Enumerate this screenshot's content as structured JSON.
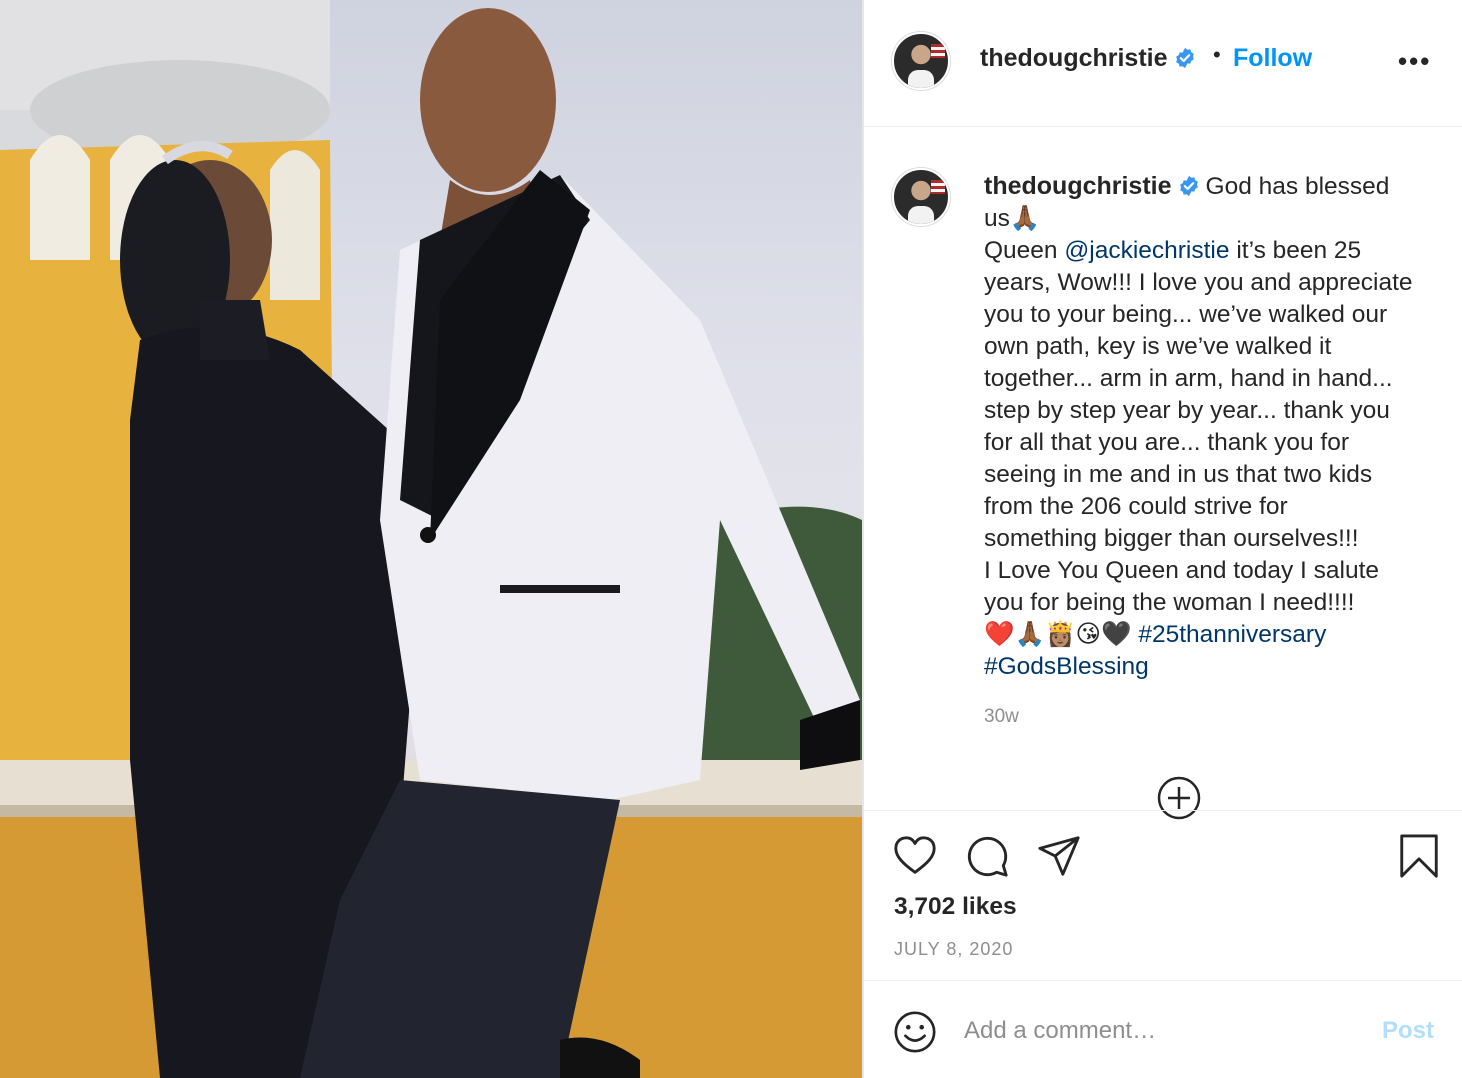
{
  "post": {
    "author": "thedougchristie",
    "separator": "•",
    "follow_label": "Follow",
    "more_label": "•••",
    "verified_icon": "verified-badge-icon",
    "caption": {
      "author": "thedougchristie",
      "text_1": "God has blessed",
      "text_2": "us🙏🏾",
      "text_3": "Queen",
      "mention": "@jackiechristie",
      "text_4": "it’s been 25",
      "text_5": "years, Wow!!! I love you and appreciate",
      "text_6": "you to your being... we’ve walked our",
      "text_7": "own path, key is we’ve walked it",
      "text_8": "together... arm in arm, hand in hand...",
      "text_9": "step by step year by year... thank you",
      "text_10": "for all that you are... thank you for",
      "text_11": "seeing in me and in us that two kids",
      "text_12": "from the 206 could strive for",
      "text_13": "something bigger than ourselves!!!",
      "text_14": "I Love You Queen and today I salute",
      "text_15": "you for being the woman I need!!!!",
      "emojis": "❤️🙏🏾👸🏽😘🖤",
      "hashtag_1": "#25thanniversary",
      "hashtag_2": "#GodsBlessing"
    },
    "time_ago": "30w",
    "likes": "3,702 likes",
    "date": "JULY 8, 2020",
    "comment_placeholder": "Add a comment…",
    "post_label": "Post"
  },
  "colors": {
    "link_blue": "#0095f6",
    "mention_blue": "#00376b",
    "muted": "#8e8e8e",
    "post_disabled": "#b2dffc"
  }
}
